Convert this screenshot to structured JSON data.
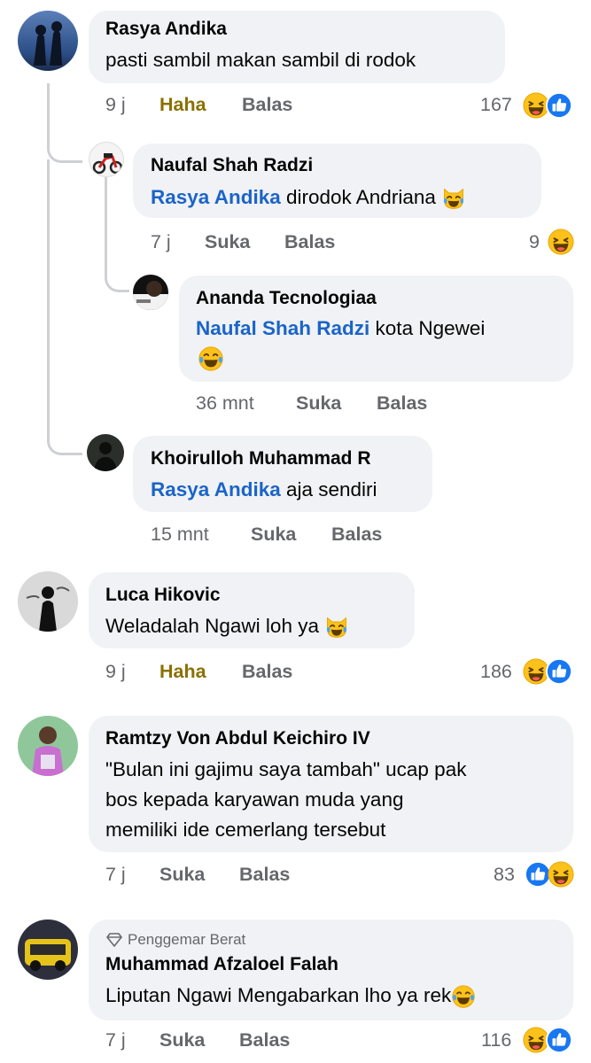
{
  "comments": [
    {
      "author": "Rasya Andika",
      "text": "pasti sambil makan sambil di rodok",
      "time": "9 j",
      "like_label": "Haha",
      "reply_label": "Balas",
      "reaction_count": "167"
    },
    {
      "author": "Naufal Shah Radzi",
      "mention": "Rasya Andika",
      "text": " dirodok Andriana ",
      "time": "7 j",
      "like_label": "Suka",
      "reply_label": "Balas",
      "reaction_count": "9"
    },
    {
      "author": "Ananda Tecnologiaa",
      "mention": "Naufal Shah Radzi",
      "text": " kota Ngewei",
      "time": "36 mnt",
      "like_label": "Suka",
      "reply_label": "Balas"
    },
    {
      "author": "Khoirulloh Muhammad R",
      "mention": "Rasya Andika",
      "text": " aja sendiri",
      "time": "15 mnt",
      "like_label": "Suka",
      "reply_label": "Balas"
    },
    {
      "author": "Luca Hikovic",
      "text": "Weladalah Ngawi loh ya ",
      "time": "9 j",
      "like_label": "Haha",
      "reply_label": "Balas",
      "reaction_count": "186"
    },
    {
      "author": "Ramtzy Von Abdul Keichiro IV",
      "lines": [
        "\"Bulan ini gajimu saya tambah\" ucap pak",
        "bos kepada karyawan muda yang",
        "memiliki ide cemerlang tersebut"
      ],
      "time": "7 j",
      "like_label": "Suka",
      "reply_label": "Balas",
      "reaction_count": "83"
    },
    {
      "badge": "Penggemar Berat",
      "author": "Muhammad Afzaloel Falah",
      "text": "Liputan Ngawi Mengabarkan lho ya rek",
      "time": "7 j",
      "like_label": "Suka",
      "reply_label": "Balas",
      "reaction_count": "116"
    }
  ],
  "icons": {
    "haha": "haha-emoji-icon",
    "like": "like-reaction-icon",
    "cry_laugh": "tears-of-joy-emoji-icon",
    "laugh_cat": "cat-tears-of-joy-emoji-icon",
    "diamond": "diamond-badge-icon"
  },
  "colors": {
    "bubble": "#f0f2f5",
    "mention": "#1b64c8",
    "meta": "#65676b",
    "haha_active": "#8a7000",
    "like_blue": "#1877f2",
    "emoji_yellow": "#fcc21b"
  }
}
